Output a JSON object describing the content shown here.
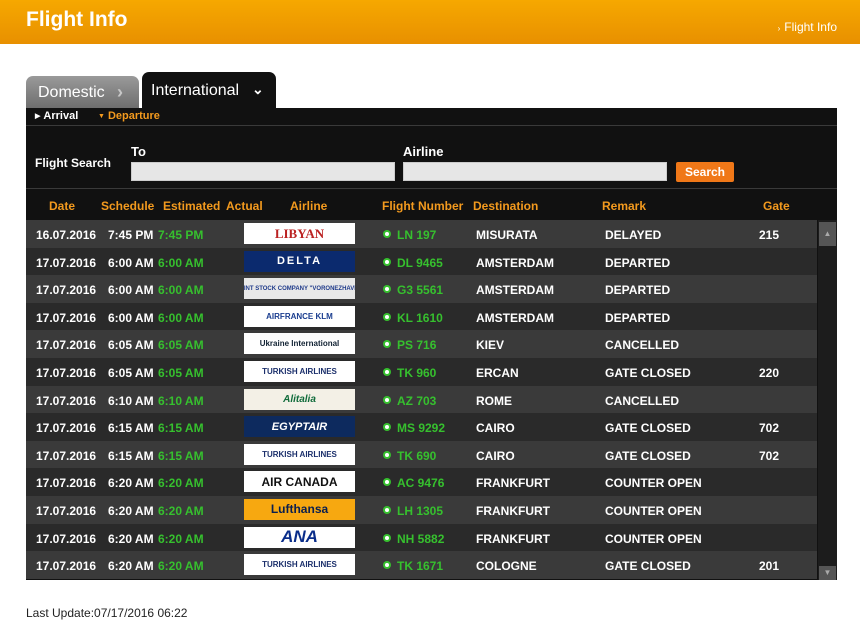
{
  "header": {
    "title": "Flight Info",
    "breadcrumb": "Flight Info"
  },
  "tabs": {
    "domestic": "Domestic",
    "international": "International"
  },
  "subnav": {
    "arrival": "Arrival",
    "departure": "Departure"
  },
  "search": {
    "label": "Flight Search",
    "to_label": "To",
    "airline_label": "Airline",
    "to_value": "",
    "airline_value": "",
    "button": "Search"
  },
  "columns": {
    "date": "Date",
    "schedule": "Schedule",
    "estimated": "Estimated",
    "actual": "Actual",
    "airline": "Airline",
    "flight_number": "Flight Number",
    "destination": "Destination",
    "remark": "Remark",
    "gate": "Gate"
  },
  "rows": [
    {
      "date": "16.07.2016",
      "schedule": "7:45 PM",
      "estimated": "7:45 PM",
      "airline_logo": "LIBYAN",
      "flight": "LN 197",
      "destination": "MISURATA",
      "remark": "DELAYED",
      "gate": "215"
    },
    {
      "date": "17.07.2016",
      "schedule": "6:00 AM",
      "estimated": "6:00 AM",
      "airline_logo": "DELTA",
      "flight": "DL 9465",
      "destination": "AMSTERDAM",
      "remark": "DEPARTED",
      "gate": ""
    },
    {
      "date": "17.07.2016",
      "schedule": "6:00 AM",
      "estimated": "6:00 AM",
      "airline_logo": "JOINT STOCK COMPANY \"VORONEZHAVIA\"",
      "flight": "G3 5561",
      "destination": "AMSTERDAM",
      "remark": "DEPARTED",
      "gate": ""
    },
    {
      "date": "17.07.2016",
      "schedule": "6:00 AM",
      "estimated": "6:00 AM",
      "airline_logo": "AIRFRANCE KLM",
      "flight": "KL 1610",
      "destination": "AMSTERDAM",
      "remark": "DEPARTED",
      "gate": ""
    },
    {
      "date": "17.07.2016",
      "schedule": "6:05 AM",
      "estimated": "6:05 AM",
      "airline_logo": "Ukraine International",
      "flight": "PS 716",
      "destination": "KIEV",
      "remark": "CANCELLED",
      "gate": ""
    },
    {
      "date": "17.07.2016",
      "schedule": "6:05 AM",
      "estimated": "6:05 AM",
      "airline_logo": "TURKISH AIRLINES",
      "flight": "TK 960",
      "destination": "ERCAN",
      "remark": "GATE CLOSED",
      "gate": "220"
    },
    {
      "date": "17.07.2016",
      "schedule": "6:10 AM",
      "estimated": "6:10 AM",
      "airline_logo": "Alitalia",
      "flight": "AZ 703",
      "destination": "ROME",
      "remark": "CANCELLED",
      "gate": ""
    },
    {
      "date": "17.07.2016",
      "schedule": "6:15 AM",
      "estimated": "6:15 AM",
      "airline_logo": "EGYPTAIR",
      "flight": "MS 9292",
      "destination": "CAIRO",
      "remark": "GATE CLOSED",
      "gate": "702"
    },
    {
      "date": "17.07.2016",
      "schedule": "6:15 AM",
      "estimated": "6:15 AM",
      "airline_logo": "TURKISH AIRLINES",
      "flight": "TK 690",
      "destination": "CAIRO",
      "remark": "GATE CLOSED",
      "gate": "702"
    },
    {
      "date": "17.07.2016",
      "schedule": "6:20 AM",
      "estimated": "6:20 AM",
      "airline_logo": "AIR CANADA",
      "flight": "AC 9476",
      "destination": "FRANKFURT",
      "remark": "COUNTER OPEN",
      "gate": ""
    },
    {
      "date": "17.07.2016",
      "schedule": "6:20 AM",
      "estimated": "6:20 AM",
      "airline_logo": "Lufthansa",
      "flight": "LH 1305",
      "destination": "FRANKFURT",
      "remark": "COUNTER OPEN",
      "gate": ""
    },
    {
      "date": "17.07.2016",
      "schedule": "6:20 AM",
      "estimated": "6:20 AM",
      "airline_logo": "ANA",
      "flight": "NH 5882",
      "destination": "FRANKFURT",
      "remark": "COUNTER OPEN",
      "gate": ""
    },
    {
      "date": "17.07.2016",
      "schedule": "6:20 AM",
      "estimated": "6:20 AM",
      "airline_logo": "TURKISH AIRLINES",
      "flight": "TK 1671",
      "destination": "COLOGNE",
      "remark": "GATE CLOSED",
      "gate": "201"
    }
  ],
  "footer": {
    "last_update": "Last Update:07/17/2016 06:22"
  }
}
